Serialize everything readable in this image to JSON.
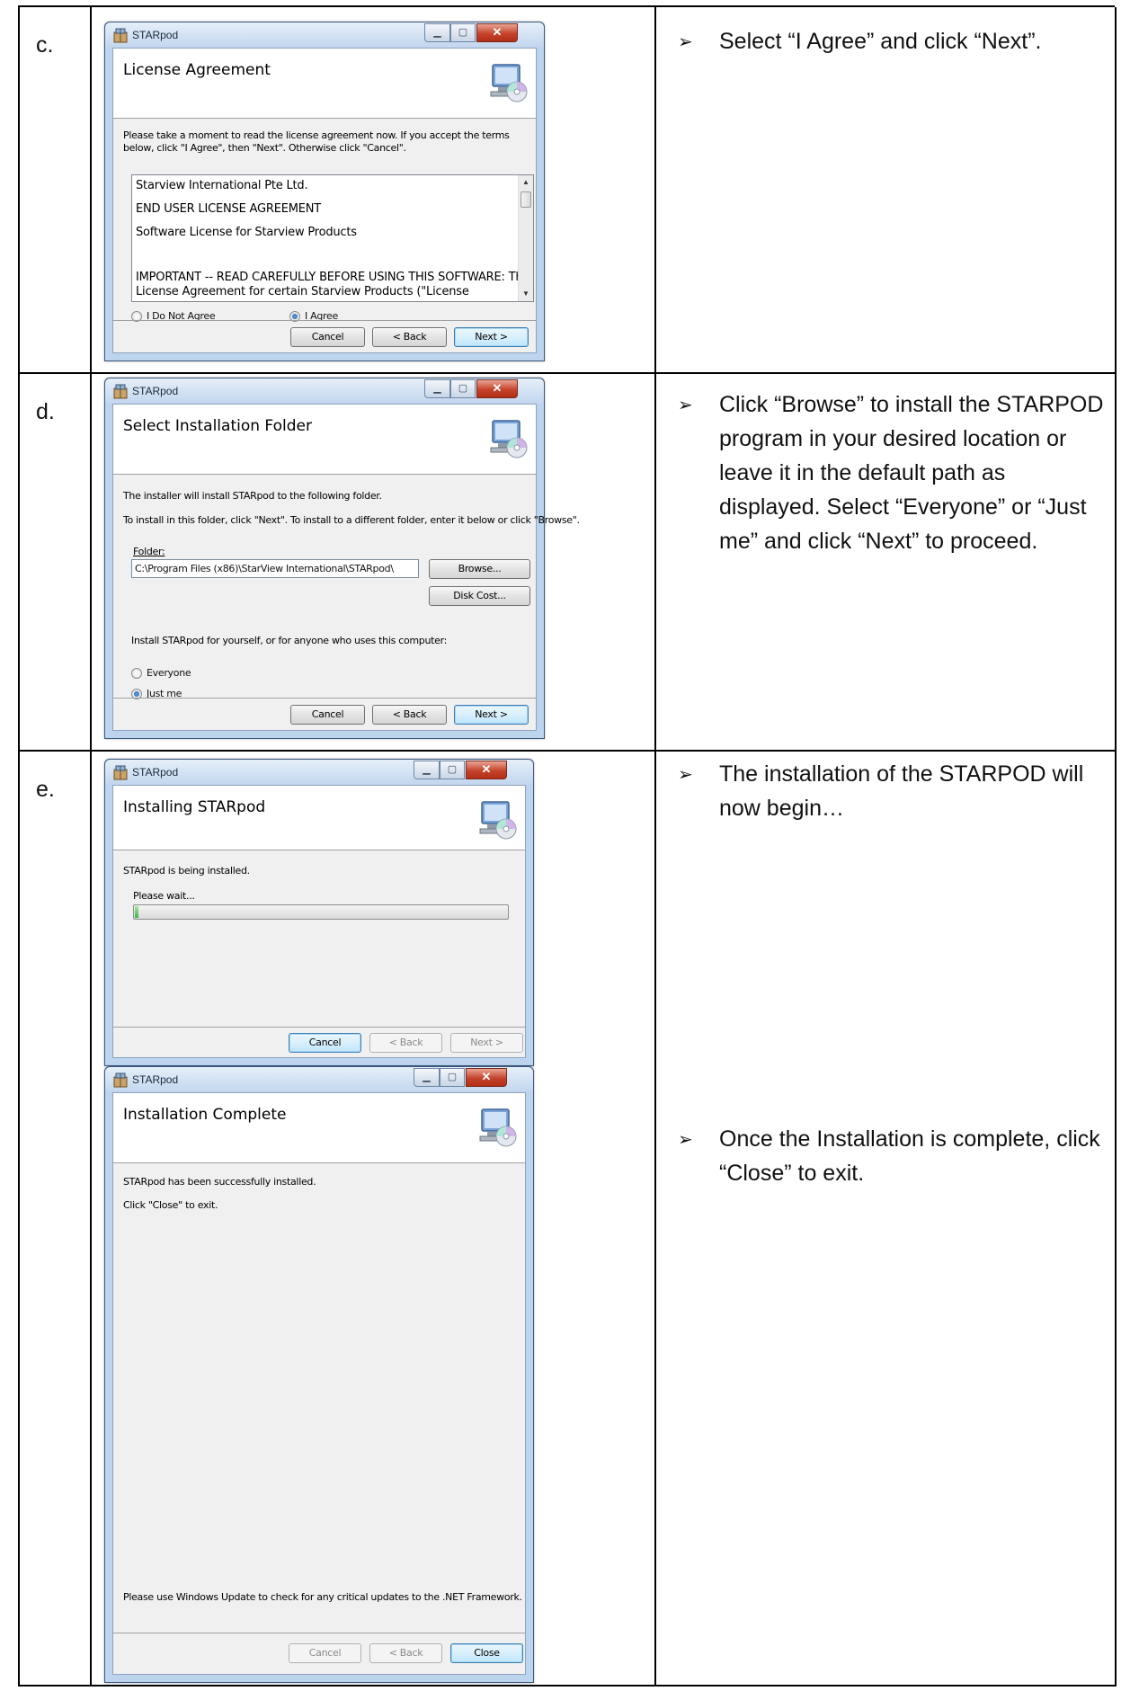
{
  "steps": [
    {
      "letter": "c.",
      "bullets": [
        "Select “I Agree” and click “Next”."
      ],
      "dialog": {
        "title": "STARpod",
        "heading": "License Agreement",
        "intro": "Please take a moment to read the license agreement now. If you accept the terms below, click \"I Agree\", then \"Next\". Otherwise click \"Cancel\".",
        "license_lines": [
          "Starview International Pte Ltd.",
          "END USER LICENSE AGREEMENT",
          "Software License for Starview Products",
          "",
          "IMPORTANT -- READ CAREFULLY BEFORE USING THIS SOFTWARE: This",
          "License Agreement for certain Starview Products (\"License"
        ],
        "radio_disagree": "I Do Not Agree",
        "radio_agree": "I Agree",
        "selected": "I Agree",
        "cancel": "Cancel",
        "back": "< Back",
        "next": "Next >"
      }
    },
    {
      "letter": "d.",
      "bullets": [
        "Click “Browse” to install the STARPOD program in your desired location or leave it in the default path as displayed. Select “Everyone” or “Just me” and click “Next” to proceed."
      ],
      "dialog": {
        "title": "STARpod",
        "heading": "Select Installation Folder",
        "line1": "The installer will install STARpod to the following folder.",
        "line2": "To install in this folder, click \"Next\". To install to a different folder, enter it below or click \"Browse\".",
        "folder_label": "Folder:",
        "folder_value": "C:\\Program Files (x86)\\StarView International\\STARpod\\",
        "browse": "Browse...",
        "disk_cost": "Disk Cost...",
        "install_for": "Install STARpod for yourself, or for anyone who uses this computer:",
        "radio_everyone": "Everyone",
        "radio_justme": "Just me",
        "selected": "Just me",
        "cancel": "Cancel",
        "back": "< Back",
        "next": "Next >"
      }
    },
    {
      "letter": "e.",
      "bullets": [
        "The installation of the STARPOD will now begin…",
        "Once the Installation is complete, click “Close” to exit."
      ],
      "dialog_installing": {
        "title": "STARpod",
        "heading": "Installing STARpod",
        "status": "STARpod is being installed.",
        "wait": "Please wait...",
        "progress": 0.01,
        "cancel": "Cancel",
        "back": "< Back",
        "next": "Next >"
      },
      "dialog_complete": {
        "title": "STARpod",
        "heading": "Installation Complete",
        "line1": "STARpod has been successfully installed.",
        "line2": "Click \"Close\" to exit.",
        "footer_note": "Please use Windows Update to check for any critical updates to the .NET Framework.",
        "cancel": "Cancel",
        "back": "< Back",
        "close": "Close"
      }
    }
  ],
  "icons": {
    "app": "installer-package-icon",
    "setup": "computer-cd-setup-icon",
    "minimize": "minimize-icon",
    "maximize": "maximize-icon",
    "close": "close-icon",
    "bullet": "arrow-bullet-icon"
  },
  "colors": {
    "close_button": "#c5432a",
    "default_button_border": "#3c7fb1",
    "frame": "#bcd4ee",
    "progress_fill": "#37b44a"
  }
}
